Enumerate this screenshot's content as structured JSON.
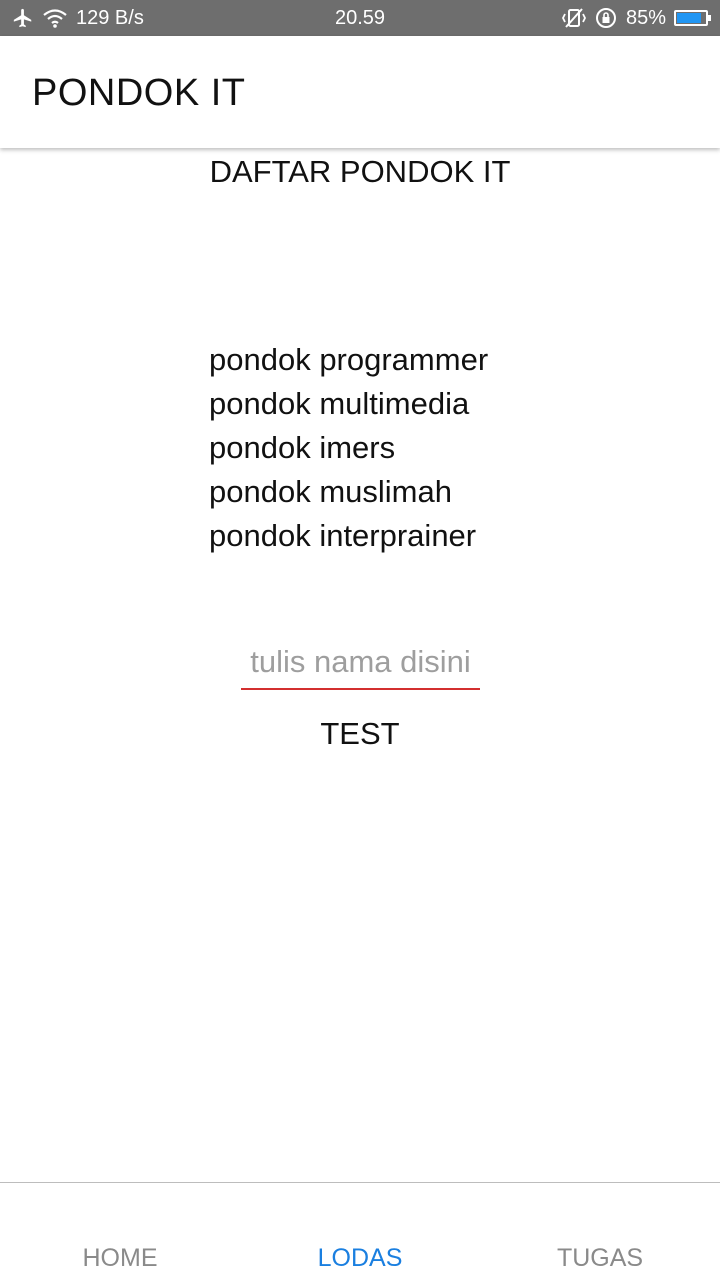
{
  "status_bar": {
    "net_speed": "129 B/s",
    "time": "20.59",
    "battery_percent": "85%",
    "battery_level": 0.85,
    "icons": [
      "airplane-icon",
      "wifi-icon",
      "vibrate-icon",
      "rotation-lock-icon",
      "battery-icon"
    ]
  },
  "app_bar": {
    "title": "PONDOK IT"
  },
  "main": {
    "heading": "DAFTAR PONDOK IT",
    "items": [
      "pondok programmer",
      "pondok multimedia",
      "pondok imers",
      "pondok muslimah",
      "pondok interprainer"
    ],
    "input": {
      "placeholder": "tulis nama disini",
      "value": ""
    },
    "button_label": "TEST"
  },
  "tabs": [
    {
      "label": "HOME",
      "active": false
    },
    {
      "label": "LODAS",
      "active": true
    },
    {
      "label": "TUGAS",
      "active": false
    }
  ],
  "colors": {
    "status_bar_bg": "#6e6e6e",
    "input_underline": "#d32f2f",
    "tab_active": "#1a7fe0",
    "tab_inactive": "#8a8a8a",
    "battery_fill": "#2196f3"
  }
}
